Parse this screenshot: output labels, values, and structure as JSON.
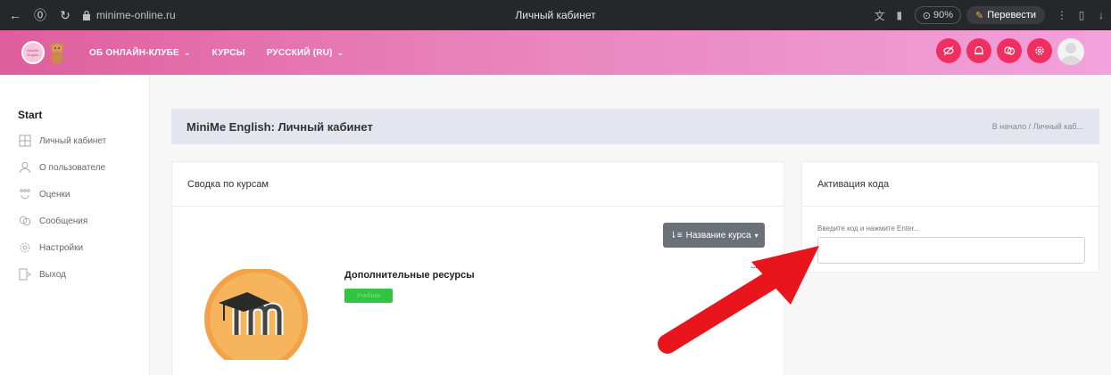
{
  "browser": {
    "url": "minime-online.ru",
    "window_title": "Личный кабинет",
    "zoom": "90%",
    "translate_label": "Перевести"
  },
  "header": {
    "logo_text": "MiniMe English",
    "menu": [
      {
        "label": "ОБ ОНЛАЙН-КЛУБЕ",
        "has_dropdown": true
      },
      {
        "label": "КУРСЫ",
        "has_dropdown": false
      },
      {
        "label": "РУССКИЙ (RU)",
        "has_dropdown": true
      }
    ],
    "icons": [
      "eye-off-icon",
      "bell-icon",
      "chat-icon",
      "gear-icon"
    ],
    "accent_color": "#ef2f61"
  },
  "sidebar": {
    "title": "Start",
    "items": [
      {
        "label": "Личный кабинет",
        "icon": "dashboard-icon"
      },
      {
        "label": "О пользователе",
        "icon": "user-icon"
      },
      {
        "label": "Оценки",
        "icon": "grades-icon"
      },
      {
        "label": "Сообщения",
        "icon": "messages-icon"
      },
      {
        "label": "Настройки",
        "icon": "settings-icon"
      },
      {
        "label": "Выход",
        "icon": "logout-icon"
      }
    ]
  },
  "page": {
    "title": "MiniMe English: Личный кабинет",
    "breadcrumb": "В начало  /  Личный каб..."
  },
  "courses_card": {
    "heading": "Сводка по курсам",
    "sort_label": "Название курса",
    "course": {
      "name": "Дополнительные ресурсы",
      "badge": "Учебник",
      "menu_dots": "..."
    }
  },
  "activation_card": {
    "heading": "Активация кода",
    "label": "Введите код и нажмите Enter...",
    "value": ""
  }
}
